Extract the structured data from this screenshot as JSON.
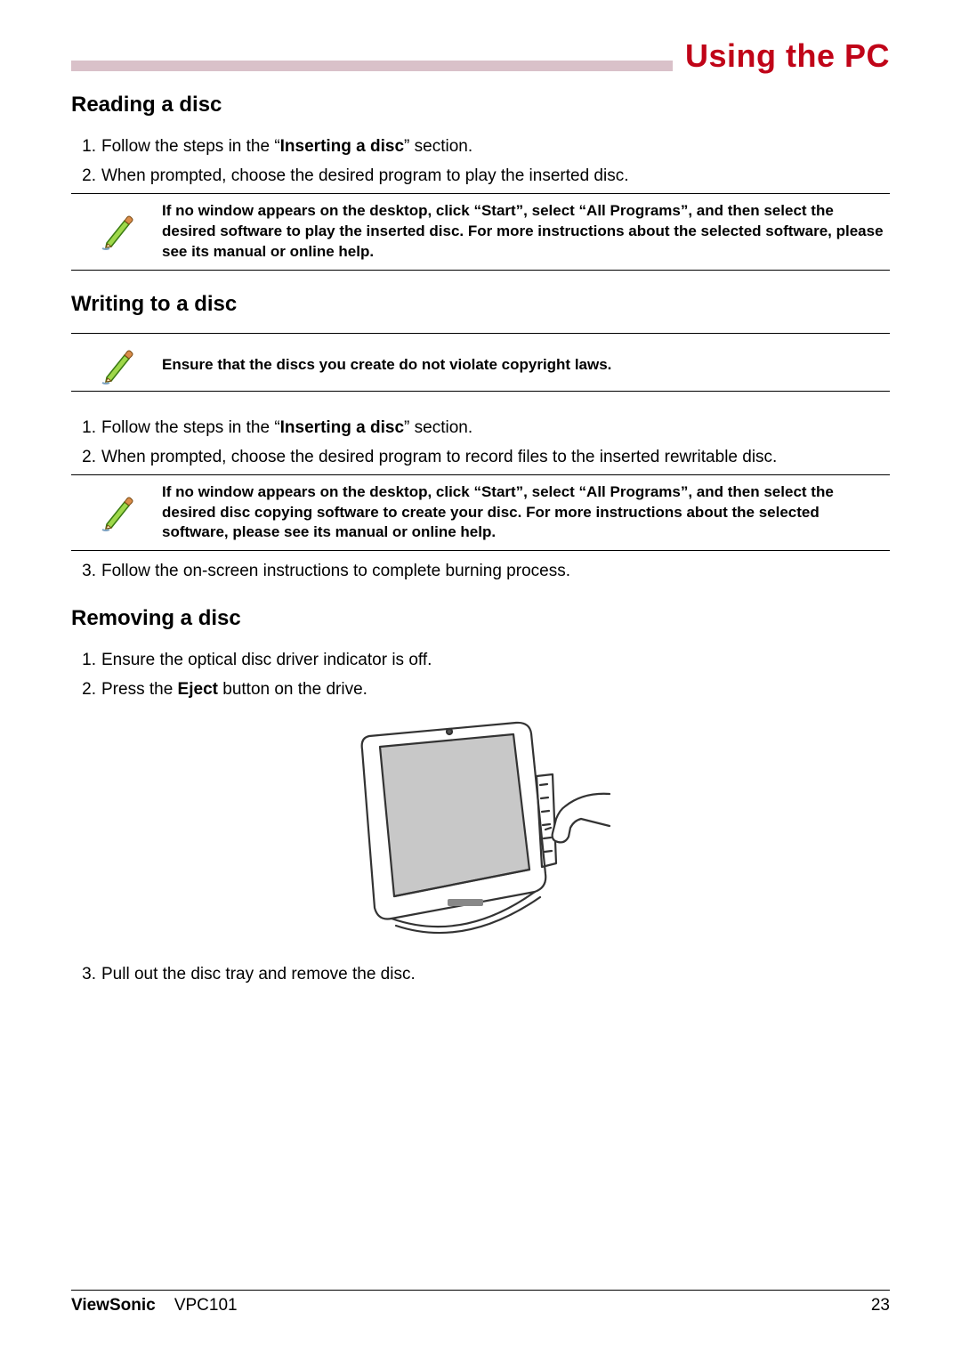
{
  "header": {
    "chapter_title": "Using the PC"
  },
  "sections": {
    "reading": {
      "heading": "Reading a disc",
      "step1_pre": "Follow the steps in the “",
      "step1_bold": "Inserting a disc",
      "step1_post": "” section.",
      "step2": "When prompted, choose the desired program to play the inserted disc.",
      "note": "If no window appears on the desktop, click “Start”, select “All Programs”, and then select the desired software to play the inserted disc. For more instructions about the selected software, please see its manual or online help."
    },
    "writing": {
      "heading": "Writing to a disc",
      "note1": "Ensure that the discs you create do not violate copyright laws.",
      "step1_pre": "Follow the steps in the “",
      "step1_bold": "Inserting a disc",
      "step1_post": "” section.",
      "step2": "When prompted, choose the desired program to record files to the inserted rewritable disc.",
      "note2": "If no window appears on the desktop, click “Start”, select “All Programs”, and then select the desired disc copying software to create your disc. For more instructions about the selected software, please see its manual or online help.",
      "step3": "Follow the on-screen instructions to complete burning process."
    },
    "removing": {
      "heading": "Removing a disc",
      "step1": "Ensure the optical disc driver indicator is off.",
      "step2_pre": "Press the ",
      "step2_bold": "Eject",
      "step2_post": " button on the drive.",
      "step3": "Pull out the disc tray and remove the disc."
    }
  },
  "footer": {
    "brand": "ViewSonic",
    "model": "VPC101",
    "page_number": "23"
  },
  "icons": {
    "note_pencil": "note-pencil-icon"
  }
}
